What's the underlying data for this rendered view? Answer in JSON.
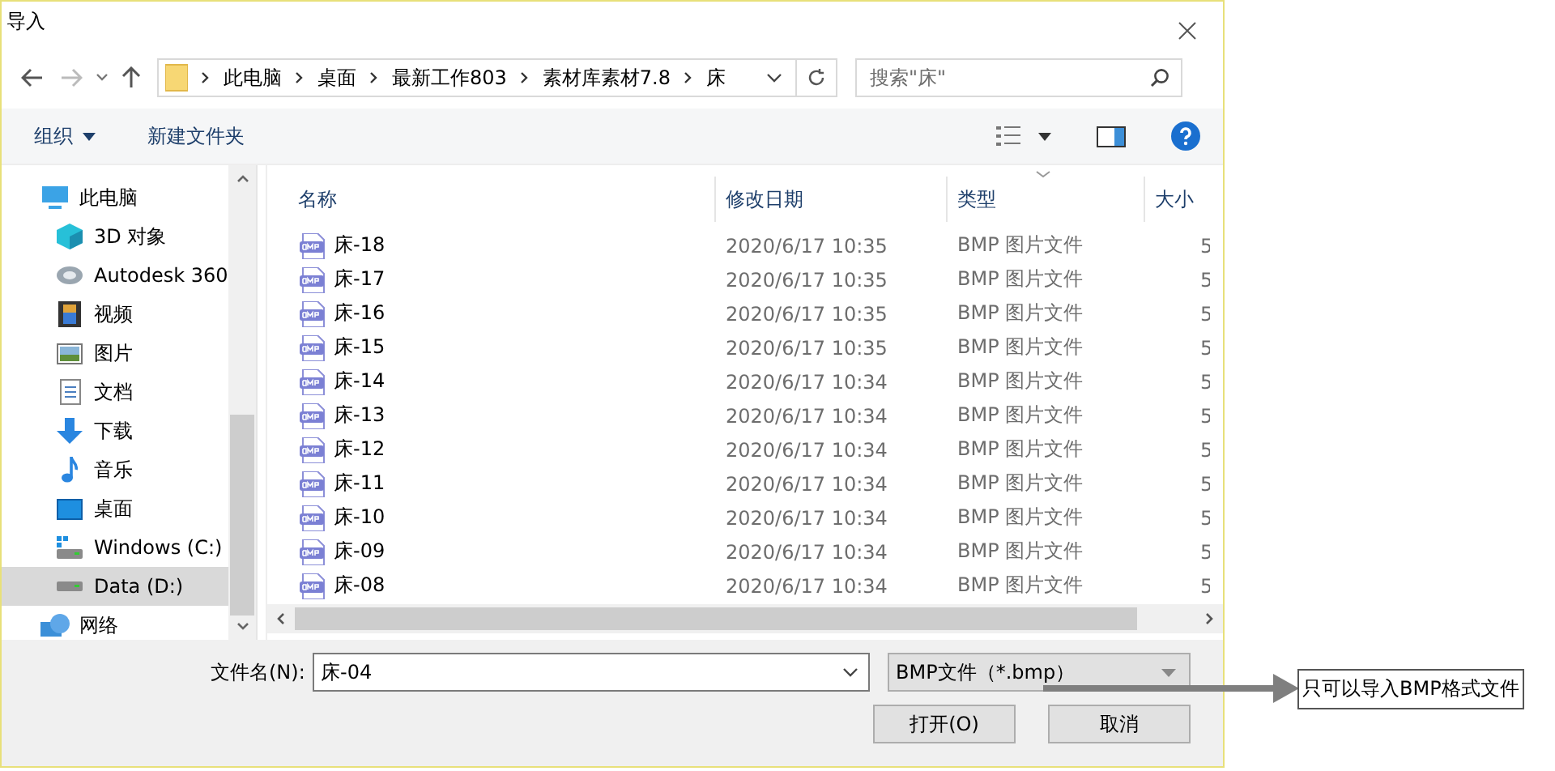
{
  "window": {
    "title": "导入"
  },
  "breadcrumbs": [
    "此电脑",
    "桌面",
    "最新工作803",
    "素材库素材7.8",
    "床"
  ],
  "search": {
    "placeholder": "搜索\"床\""
  },
  "toolbar": {
    "organize": "组织",
    "new_folder": "新建文件夹"
  },
  "nav_tree": [
    {
      "label": "此电脑",
      "kind": "pc",
      "selected": false,
      "children": [
        {
          "label": "3D 对象",
          "kind": "cube",
          "selected": false
        },
        {
          "label": "Autodesk 360",
          "kind": "cloud",
          "selected": false
        },
        {
          "label": "视频",
          "kind": "video",
          "selected": false
        },
        {
          "label": "图片",
          "kind": "picture",
          "selected": false
        },
        {
          "label": "文档",
          "kind": "doc",
          "selected": false
        },
        {
          "label": "下载",
          "kind": "download",
          "selected": false
        },
        {
          "label": "音乐",
          "kind": "music",
          "selected": false
        },
        {
          "label": "桌面",
          "kind": "desktop",
          "selected": false
        },
        {
          "label": "Windows (C:)",
          "kind": "drive-c",
          "selected": false
        },
        {
          "label": "Data (D:)",
          "kind": "drive",
          "selected": true
        }
      ]
    },
    {
      "label": "网络",
      "kind": "network",
      "selected": false
    }
  ],
  "table": {
    "columns": [
      "名称",
      "修改日期",
      "类型",
      "大小"
    ],
    "rows": [
      {
        "name": "床-18",
        "date": "2020/6/17 10:35",
        "type": "BMP 图片文件",
        "size": "5"
      },
      {
        "name": "床-17",
        "date": "2020/6/17 10:35",
        "type": "BMP 图片文件",
        "size": "5"
      },
      {
        "name": "床-16",
        "date": "2020/6/17 10:35",
        "type": "BMP 图片文件",
        "size": "5"
      },
      {
        "name": "床-15",
        "date": "2020/6/17 10:35",
        "type": "BMP 图片文件",
        "size": "5"
      },
      {
        "name": "床-14",
        "date": "2020/6/17 10:34",
        "type": "BMP 图片文件",
        "size": "5"
      },
      {
        "name": "床-13",
        "date": "2020/6/17 10:34",
        "type": "BMP 图片文件",
        "size": "5"
      },
      {
        "name": "床-12",
        "date": "2020/6/17 10:34",
        "type": "BMP 图片文件",
        "size": "5"
      },
      {
        "name": "床-11",
        "date": "2020/6/17 10:34",
        "type": "BMP 图片文件",
        "size": "5"
      },
      {
        "name": "床-10",
        "date": "2020/6/17 10:34",
        "type": "BMP 图片文件",
        "size": "5"
      },
      {
        "name": "床-09",
        "date": "2020/6/17 10:34",
        "type": "BMP 图片文件",
        "size": "5"
      },
      {
        "name": "床-08",
        "date": "2020/6/17 10:34",
        "type": "BMP 图片文件",
        "size": "5"
      }
    ]
  },
  "file_name": {
    "label": "文件名(N):",
    "value": "床-04"
  },
  "file_type": {
    "value": "BMP文件（*.bmp）"
  },
  "buttons": [
    "打开(O)",
    "取消"
  ],
  "annotation": {
    "text": "只可以导入BMP格式文件"
  }
}
